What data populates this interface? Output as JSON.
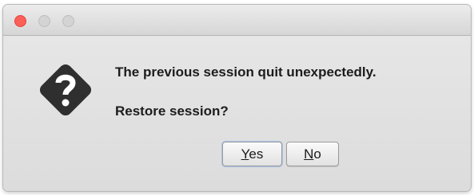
{
  "window": {
    "title": "",
    "controls": {
      "close": "close",
      "minimize": "minimize",
      "zoom": "zoom"
    }
  },
  "dialog": {
    "icon": "question-diamond-icon",
    "message": "The previous session quit unexpectedly.",
    "question": "Restore session?"
  },
  "buttons": {
    "yes": {
      "mnemonic": "Y",
      "rest": "es"
    },
    "no": {
      "mnemonic": "N",
      "rest": "o"
    }
  },
  "colors": {
    "close_button": "#fc5f57",
    "icon_fill": "#2f2f2f",
    "default_button_ring": "#a9c3e6"
  }
}
